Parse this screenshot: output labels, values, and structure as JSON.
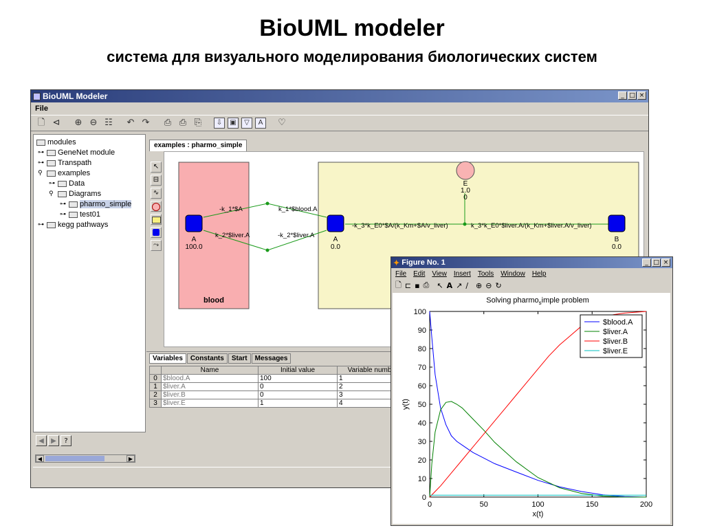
{
  "slide": {
    "title": "BioUML modeler",
    "subtitle": "система для визуального моделирования биологических систем"
  },
  "main_window": {
    "title": "BioUML Modeler",
    "menu": [
      "File"
    ],
    "win_controls": {
      "minimize": "_",
      "maximize": "□",
      "close": "×"
    },
    "toolbar_icons": [
      "new-icon",
      "open-icon",
      "zoom-in-icon",
      "zoom-out-icon",
      "layout-icon",
      "undo-icon",
      "redo-icon",
      "print-icon",
      "print-preview-icon",
      "page-setup-icon",
      "export-icon",
      "image-icon",
      "filter-icon",
      "text-icon",
      "comment-icon"
    ]
  },
  "tree": {
    "items": [
      {
        "label": "modules",
        "depth": 0,
        "toggle": ""
      },
      {
        "label": "GeneNet module",
        "depth": 1,
        "toggle": "⚬-"
      },
      {
        "label": "Transpath",
        "depth": 1,
        "toggle": "⚬-"
      },
      {
        "label": "examples",
        "depth": 1,
        "toggle": "⚲"
      },
      {
        "label": "Data",
        "depth": 2,
        "toggle": "⚬-"
      },
      {
        "label": "Diagrams",
        "depth": 2,
        "toggle": "⚲"
      },
      {
        "label": "pharmo_simple",
        "depth": 3,
        "toggle": "⚬-",
        "selected": true
      },
      {
        "label": "test01",
        "depth": 3,
        "toggle": "⚬-"
      },
      {
        "label": "kegg pathways",
        "depth": 1,
        "toggle": "⚬-"
      }
    ]
  },
  "diagram": {
    "tab": "examples : pharmo_simple",
    "compartments": {
      "blood": "blood"
    },
    "nodes": {
      "blood_a": {
        "name": "A",
        "value": "100.0"
      },
      "liver_a": {
        "name": "A",
        "value": "0.0"
      },
      "liver_b": {
        "name": "B",
        "value": "0.0"
      },
      "liver_e": {
        "name": "E",
        "value": "1.0",
        "value2": "0"
      }
    },
    "reactions": {
      "r1": "-k_1*$A",
      "r1b": "k_1*$blood.A",
      "r2": "k_2*$liver.A",
      "r2b": "-k_2*$liver.A",
      "r3": "-k_3*k_E0*$A/(k_Km+$A/v_liver)",
      "r3b": "k_3*k_E0*$liver.A/(k_Km+$liver.A/v_liver)"
    },
    "colors": {
      "blood": "#f9aeb0",
      "liver": "#f8f5c8",
      "node": "#0000ee",
      "enzyme": "#f9b3b3",
      "edge": "#1a9a1a"
    }
  },
  "bottom_panel": {
    "tabs": [
      "Variables",
      "Constants",
      "Start",
      "Messages"
    ],
    "active_tab": "Variables",
    "table": {
      "headers": [
        "",
        "Name",
        "Initial value",
        "Variable number"
      ],
      "rows": [
        [
          "0",
          "$blood.A",
          "100",
          "1"
        ],
        [
          "1",
          "$liver.A",
          "0",
          "2"
        ],
        [
          "2",
          "$liver.B",
          "0",
          "3"
        ],
        [
          "3",
          "$liver.E",
          "1",
          "4"
        ]
      ]
    }
  },
  "figure": {
    "title": "Figure No. 1",
    "menu": [
      "File",
      "Edit",
      "View",
      "Insert",
      "Tools",
      "Window",
      "Help"
    ],
    "toolbar_icons": [
      "new-icon",
      "open-icon",
      "save-icon",
      "print-icon",
      "select-arrow-icon",
      "text-tool-icon",
      "arrow-tool-icon",
      "line-tool-icon",
      "zoom-in-icon",
      "zoom-out-icon",
      "rotate-icon"
    ]
  },
  "chart_data": {
    "type": "line",
    "title_prefix": "Solving pharmo",
    "title_subscript": "s",
    "title_suffix": "imple problem",
    "xlabel": "x(t)",
    "ylabel": "y(t)",
    "xlim": [
      0,
      200
    ],
    "ylim": [
      0,
      100
    ],
    "xticks": [
      0,
      50,
      100,
      150,
      200
    ],
    "yticks": [
      0,
      10,
      20,
      30,
      40,
      50,
      60,
      70,
      80,
      90,
      100
    ],
    "legend_position": "top-right",
    "series": [
      {
        "name": "$blood.A",
        "color": "#0000ff",
        "x": [
          0,
          2,
          5,
          10,
          15,
          20,
          25,
          30,
          40,
          50,
          60,
          80,
          100,
          120,
          140,
          160,
          180,
          200
        ],
        "y": [
          100,
          86,
          66,
          48,
          39,
          33,
          30,
          28,
          24,
          21,
          18,
          13.5,
          9,
          5.5,
          3,
          1.2,
          0.3,
          0
        ]
      },
      {
        "name": "$liver.A",
        "color": "#008000",
        "x": [
          0,
          2,
          5,
          10,
          15,
          20,
          25,
          30,
          40,
          50,
          60,
          80,
          100,
          120,
          140,
          160,
          180,
          200
        ],
        "y": [
          0,
          18,
          35,
          47,
          51,
          51.5,
          50,
          48,
          42,
          36,
          29.5,
          19,
          10.5,
          5,
          2,
          0.5,
          0,
          0
        ]
      },
      {
        "name": "$liver.B",
        "color": "#ff0000",
        "x": [
          0,
          10,
          20,
          30,
          40,
          50,
          60,
          70,
          80,
          90,
          100,
          110,
          120,
          130,
          140,
          150,
          160,
          170,
          180,
          190,
          200
        ],
        "y": [
          0,
          6,
          13,
          20,
          27,
          34,
          41,
          48,
          55,
          62,
          69,
          76,
          82,
          87,
          92,
          95,
          97,
          98.3,
          99.1,
          99.6,
          100
        ]
      },
      {
        "name": "$liver.E",
        "color": "#00bfbf",
        "x": [
          0,
          200
        ],
        "y": [
          1,
          1
        ]
      }
    ]
  }
}
